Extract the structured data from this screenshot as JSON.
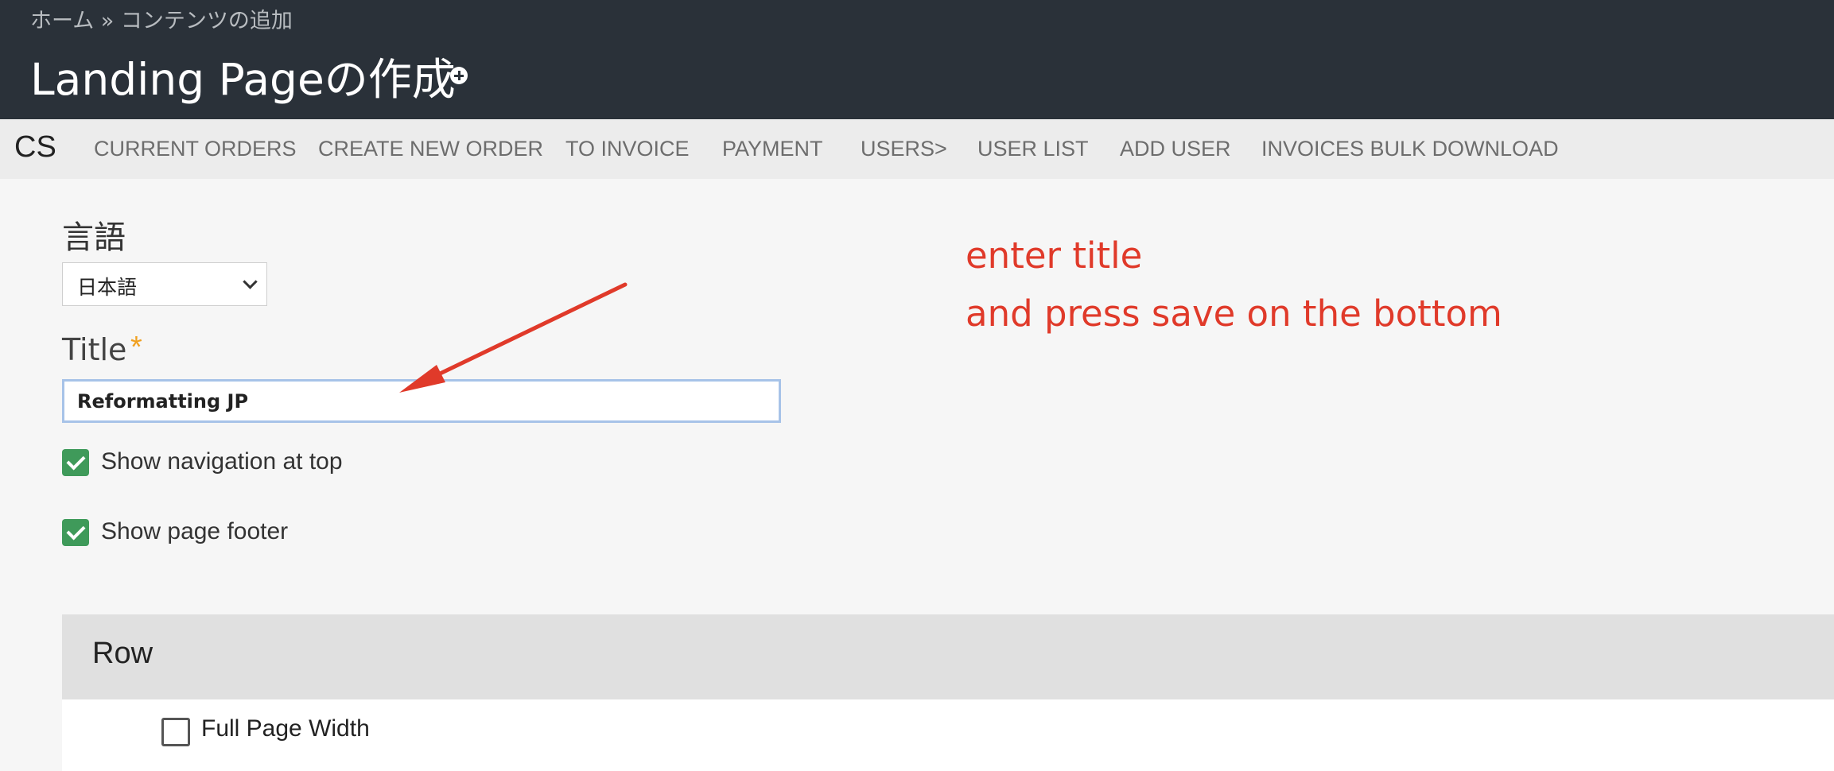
{
  "header": {
    "breadcrumb": "ホーム » コンテンツの追加",
    "title": "Landing Pageの作成"
  },
  "nav": {
    "brand": "CS",
    "items": [
      "CURRENT ORDERS",
      "CREATE NEW ORDER",
      "TO INVOICE",
      "PAYMENT",
      "USERS>",
      "USER LIST",
      "ADD USER",
      "INVOICES BULK DOWNLOAD"
    ]
  },
  "form": {
    "language_label": "言語",
    "language_value": "日本語",
    "title_label": "Title",
    "required_mark": "*",
    "title_value": "Reformatting JP",
    "show_navigation_label": "Show navigation at top",
    "show_footer_label": "Show page footer"
  },
  "row": {
    "title": "Row",
    "full_width_label": "Full Page Width"
  },
  "annotation": {
    "line1": "enter title",
    "line2": "and press save on the bottom",
    "color": "#e03a2a"
  },
  "colors": {
    "header_bg": "#2a3139",
    "checkbox_green": "#3f9a5a",
    "required_star": "#f0a020"
  }
}
